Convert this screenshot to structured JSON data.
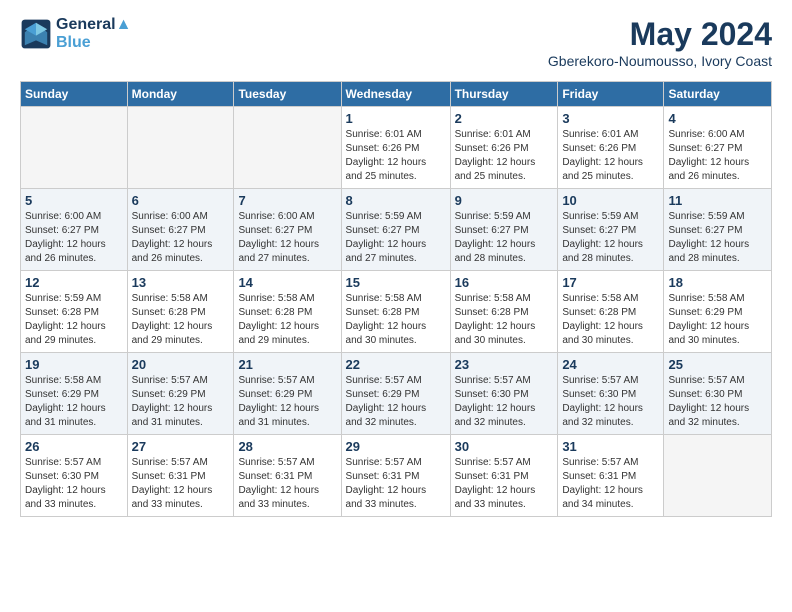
{
  "header": {
    "logo_line1": "General",
    "logo_line2": "Blue",
    "month_year": "May 2024",
    "location": "Gberekoro-Noumousso, Ivory Coast"
  },
  "days_of_week": [
    "Sunday",
    "Monday",
    "Tuesday",
    "Wednesday",
    "Thursday",
    "Friday",
    "Saturday"
  ],
  "weeks": [
    [
      {
        "day": "",
        "info": ""
      },
      {
        "day": "",
        "info": ""
      },
      {
        "day": "",
        "info": ""
      },
      {
        "day": "1",
        "info": "Sunrise: 6:01 AM\nSunset: 6:26 PM\nDaylight: 12 hours\nand 25 minutes."
      },
      {
        "day": "2",
        "info": "Sunrise: 6:01 AM\nSunset: 6:26 PM\nDaylight: 12 hours\nand 25 minutes."
      },
      {
        "day": "3",
        "info": "Sunrise: 6:01 AM\nSunset: 6:26 PM\nDaylight: 12 hours\nand 25 minutes."
      },
      {
        "day": "4",
        "info": "Sunrise: 6:00 AM\nSunset: 6:27 PM\nDaylight: 12 hours\nand 26 minutes."
      }
    ],
    [
      {
        "day": "5",
        "info": "Sunrise: 6:00 AM\nSunset: 6:27 PM\nDaylight: 12 hours\nand 26 minutes."
      },
      {
        "day": "6",
        "info": "Sunrise: 6:00 AM\nSunset: 6:27 PM\nDaylight: 12 hours\nand 26 minutes."
      },
      {
        "day": "7",
        "info": "Sunrise: 6:00 AM\nSunset: 6:27 PM\nDaylight: 12 hours\nand 27 minutes."
      },
      {
        "day": "8",
        "info": "Sunrise: 5:59 AM\nSunset: 6:27 PM\nDaylight: 12 hours\nand 27 minutes."
      },
      {
        "day": "9",
        "info": "Sunrise: 5:59 AM\nSunset: 6:27 PM\nDaylight: 12 hours\nand 28 minutes."
      },
      {
        "day": "10",
        "info": "Sunrise: 5:59 AM\nSunset: 6:27 PM\nDaylight: 12 hours\nand 28 minutes."
      },
      {
        "day": "11",
        "info": "Sunrise: 5:59 AM\nSunset: 6:27 PM\nDaylight: 12 hours\nand 28 minutes."
      }
    ],
    [
      {
        "day": "12",
        "info": "Sunrise: 5:59 AM\nSunset: 6:28 PM\nDaylight: 12 hours\nand 29 minutes."
      },
      {
        "day": "13",
        "info": "Sunrise: 5:58 AM\nSunset: 6:28 PM\nDaylight: 12 hours\nand 29 minutes."
      },
      {
        "day": "14",
        "info": "Sunrise: 5:58 AM\nSunset: 6:28 PM\nDaylight: 12 hours\nand 29 minutes."
      },
      {
        "day": "15",
        "info": "Sunrise: 5:58 AM\nSunset: 6:28 PM\nDaylight: 12 hours\nand 30 minutes."
      },
      {
        "day": "16",
        "info": "Sunrise: 5:58 AM\nSunset: 6:28 PM\nDaylight: 12 hours\nand 30 minutes."
      },
      {
        "day": "17",
        "info": "Sunrise: 5:58 AM\nSunset: 6:28 PM\nDaylight: 12 hours\nand 30 minutes."
      },
      {
        "day": "18",
        "info": "Sunrise: 5:58 AM\nSunset: 6:29 PM\nDaylight: 12 hours\nand 30 minutes."
      }
    ],
    [
      {
        "day": "19",
        "info": "Sunrise: 5:58 AM\nSunset: 6:29 PM\nDaylight: 12 hours\nand 31 minutes."
      },
      {
        "day": "20",
        "info": "Sunrise: 5:57 AM\nSunset: 6:29 PM\nDaylight: 12 hours\nand 31 minutes."
      },
      {
        "day": "21",
        "info": "Sunrise: 5:57 AM\nSunset: 6:29 PM\nDaylight: 12 hours\nand 31 minutes."
      },
      {
        "day": "22",
        "info": "Sunrise: 5:57 AM\nSunset: 6:29 PM\nDaylight: 12 hours\nand 32 minutes."
      },
      {
        "day": "23",
        "info": "Sunrise: 5:57 AM\nSunset: 6:30 PM\nDaylight: 12 hours\nand 32 minutes."
      },
      {
        "day": "24",
        "info": "Sunrise: 5:57 AM\nSunset: 6:30 PM\nDaylight: 12 hours\nand 32 minutes."
      },
      {
        "day": "25",
        "info": "Sunrise: 5:57 AM\nSunset: 6:30 PM\nDaylight: 12 hours\nand 32 minutes."
      }
    ],
    [
      {
        "day": "26",
        "info": "Sunrise: 5:57 AM\nSunset: 6:30 PM\nDaylight: 12 hours\nand 33 minutes."
      },
      {
        "day": "27",
        "info": "Sunrise: 5:57 AM\nSunset: 6:31 PM\nDaylight: 12 hours\nand 33 minutes."
      },
      {
        "day": "28",
        "info": "Sunrise: 5:57 AM\nSunset: 6:31 PM\nDaylight: 12 hours\nand 33 minutes."
      },
      {
        "day": "29",
        "info": "Sunrise: 5:57 AM\nSunset: 6:31 PM\nDaylight: 12 hours\nand 33 minutes."
      },
      {
        "day": "30",
        "info": "Sunrise: 5:57 AM\nSunset: 6:31 PM\nDaylight: 12 hours\nand 33 minutes."
      },
      {
        "day": "31",
        "info": "Sunrise: 5:57 AM\nSunset: 6:31 PM\nDaylight: 12 hours\nand 34 minutes."
      },
      {
        "day": "",
        "info": ""
      }
    ]
  ]
}
